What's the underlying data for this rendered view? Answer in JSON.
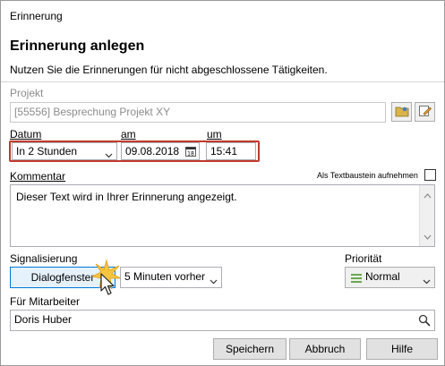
{
  "window": {
    "title": "Erinnerung"
  },
  "header": {
    "title": "Erinnerung anlegen",
    "subtitle": "Nutzen Sie die Erinnerungen für nicht abgeschlossene Tätigkeiten."
  },
  "projekt": {
    "label": "Projekt",
    "value": "[55556] Besprechung Projekt XY"
  },
  "datum": {
    "label": "Datum",
    "value": "In 2 Stunden"
  },
  "am": {
    "label": "am",
    "value": "09.08.2018"
  },
  "um": {
    "label": "um",
    "value": "15:41"
  },
  "kommentar": {
    "label": "Kommentar",
    "textbaustein_label": "Als Textbaustein aufnehmen",
    "value": "Dieser Text wird in Ihrer Erinnerung angezeigt."
  },
  "signalisierung": {
    "label": "Signalisierung",
    "button_label": "Dialogfenster",
    "interval": "5 Minuten vorher"
  },
  "prioritaet": {
    "label": "Priorität",
    "value": "Normal"
  },
  "mitarbeiter": {
    "label": "Für Mitarbeiter",
    "value": "Doris Huber"
  },
  "buttons": {
    "speichern": "Speichern",
    "abbruch": "Abbruch",
    "hilfe": "Hilfe"
  },
  "colors": {
    "highlight": "#c0392b",
    "priority": "#6aa84f"
  }
}
